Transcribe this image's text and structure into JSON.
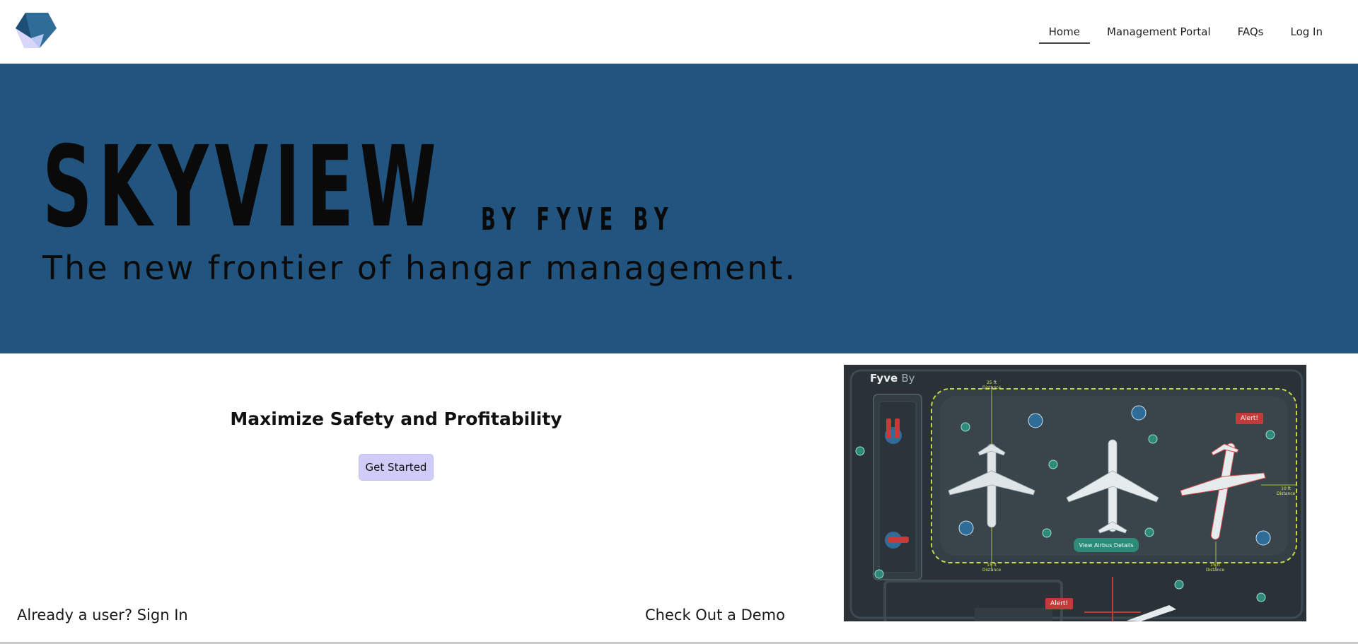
{
  "header": {
    "logo_icon": "skyview-logo-icon",
    "nav": [
      {
        "label": "Home",
        "active": true
      },
      {
        "label": "Management Portal",
        "active": false
      },
      {
        "label": "FAQs",
        "active": false
      },
      {
        "label": "Log In",
        "active": false
      }
    ]
  },
  "hero": {
    "brand": "SKYVIEW",
    "byline": "BY FYVE BY",
    "tagline": "The new frontier of hangar management.",
    "background_color": "#21547e"
  },
  "main": {
    "heading": "Maximize Safety and Profitability",
    "cta_label": "Get Started",
    "sign_in_label": "Already a user? Sign In",
    "demo_label": "Check Out a Demo"
  },
  "demo_image": {
    "brand": "Fyve",
    "brand_suffix": "By",
    "alert_label": "Alert!",
    "view_button": "View Airbus Details",
    "distances": [
      {
        "value": "25 ft",
        "label": "Distance"
      },
      {
        "value": "10 ft",
        "label": "Distance"
      },
      {
        "value": "15 ft",
        "label": "Distance"
      },
      {
        "value": "15 ft",
        "label": "Distance"
      }
    ]
  }
}
